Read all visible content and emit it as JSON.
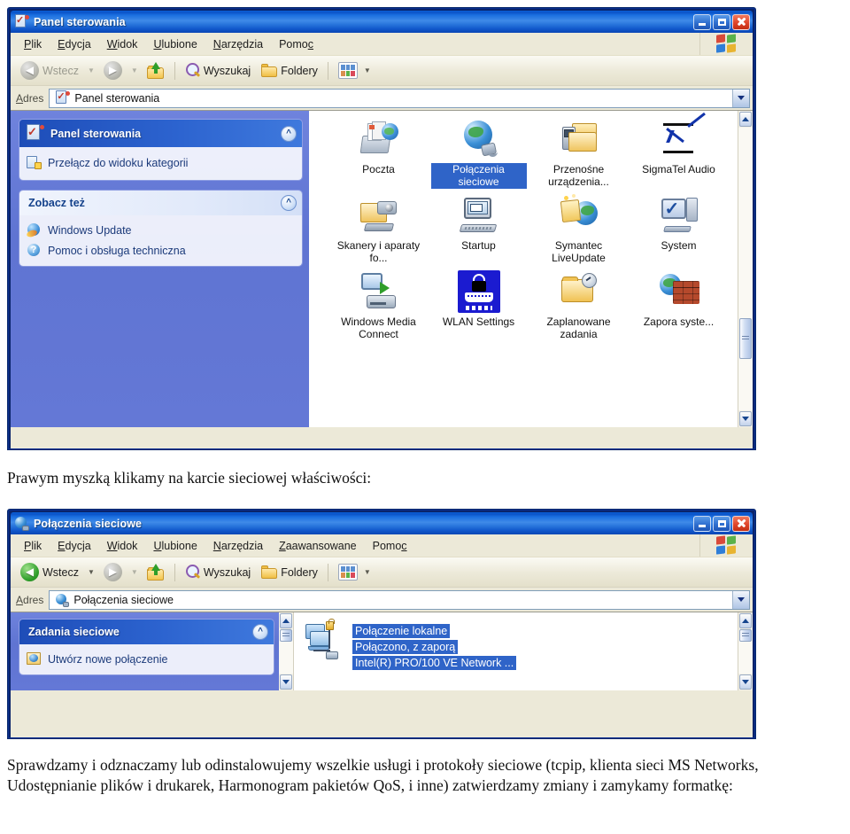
{
  "window1": {
    "title": "Panel sterowania",
    "title_icon": "control-panel-icon",
    "caption": {
      "minimize": "Minimalizuj",
      "maximize": "Maksymalizuj",
      "close": "Zamknij"
    },
    "menu": [
      "Plik",
      "Edycja",
      "Widok",
      "Ulubione",
      "Narzędzia",
      "Pomoc"
    ],
    "toolbar": {
      "back": "Wstecz",
      "forward": "",
      "up": "",
      "search": "Wyszukaj",
      "folders": "Foldery",
      "views": ""
    },
    "address": {
      "label": "Adres",
      "value": "Panel sterowania"
    },
    "panels": [
      {
        "title": "Panel sterowania",
        "style": "dark",
        "icon": "control-panel-icon",
        "links": [
          {
            "label": "Przełącz do widoku kategorii",
            "icon": "switch-view-icon"
          }
        ]
      },
      {
        "title": "Zobacz też",
        "style": "light",
        "links": [
          {
            "label": "Windows Update",
            "icon": "windows-update-icon"
          },
          {
            "label": "Pomoc i obsługa techniczna",
            "icon": "help-support-icon"
          }
        ]
      }
    ],
    "icons": [
      {
        "label": "Poczta",
        "art": "a-mail",
        "icon": "mail-icon",
        "selected": false
      },
      {
        "label": "Połączenia sieciowe",
        "art": "a-net",
        "icon": "network-connections-icon",
        "selected": true
      },
      {
        "label": "Przenośne urządzenia...",
        "art": "a-port",
        "icon": "portable-devices-icon",
        "selected": false
      },
      {
        "label": "SigmaTel Audio",
        "art": "a-sigma",
        "icon": "sigmatel-audio-icon",
        "selected": false
      },
      {
        "label": "Skanery i aparaty fo...",
        "art": "a-scan",
        "icon": "scanners-cameras-icon",
        "selected": false
      },
      {
        "label": "Startup",
        "art": "a-pc",
        "icon": "startup-icon",
        "selected": false
      },
      {
        "label": "Symantec LiveUpdate",
        "art": "a-live",
        "icon": "symantec-liveupdate-icon",
        "selected": false
      },
      {
        "label": "System",
        "art": "a-sys",
        "icon": "system-icon",
        "selected": false
      },
      {
        "label": "Windows Media Connect",
        "art": "a-wmc",
        "icon": "windows-media-connect-icon",
        "selected": false
      },
      {
        "label": "WLAN Settings",
        "art": "a-wlan",
        "icon": "wlan-settings-icon",
        "selected": false
      },
      {
        "label": "Zaplanowane zadania",
        "art": "a-task",
        "icon": "scheduled-tasks-icon",
        "selected": false
      },
      {
        "label": "Zapora syste...",
        "art": "a-fw",
        "icon": "windows-firewall-icon",
        "selected": false
      }
    ]
  },
  "caption_middle": "Prawym myszką klikamy na karcie sieciowej właściwości:",
  "window2": {
    "title": "Połączenia sieciowe",
    "title_icon": "network-connections-icon",
    "menu": [
      "Plik",
      "Edycja",
      "Widok",
      "Ulubione",
      "Narzędzia",
      "Zaawansowane",
      "Pomoc"
    ],
    "toolbar": {
      "back": "Wstecz",
      "forward": "",
      "up": "",
      "search": "Wyszukaj",
      "folders": "Foldery",
      "views": ""
    },
    "address": {
      "label": "Adres",
      "value": "Połączenia sieciowe"
    },
    "panels": [
      {
        "title": "Zadania sieciowe",
        "style": "dark",
        "links": [
          {
            "label": "Utwórz nowe połączenie",
            "icon": "new-connection-icon"
          }
        ]
      }
    ],
    "connection": {
      "name": "Połączenie lokalne",
      "status": "Połączono, z zaporą",
      "adapter": "Intel(R) PRO/100 VE Network ...",
      "icon": "lan-connection-icon",
      "selected": true
    }
  },
  "caption_bottom": "Sprawdzamy i odznaczamy lub odinstalowujemy wszelkie usługi i protokoły sieciowe (tcpip, klienta sieci MS Networks, Udostępnianie plików i drukarek, Harmonogram pakietów QoS, i inne) zatwierdzamy zmiany i zamykamy formatkę:",
  "colors": {
    "title_blue": "#0a53c8",
    "task_pane_blue": "#6478d6",
    "selection_blue": "#2f64c8",
    "chrome_beige": "#ece9d8",
    "panel_header_blue": "#15428b"
  }
}
